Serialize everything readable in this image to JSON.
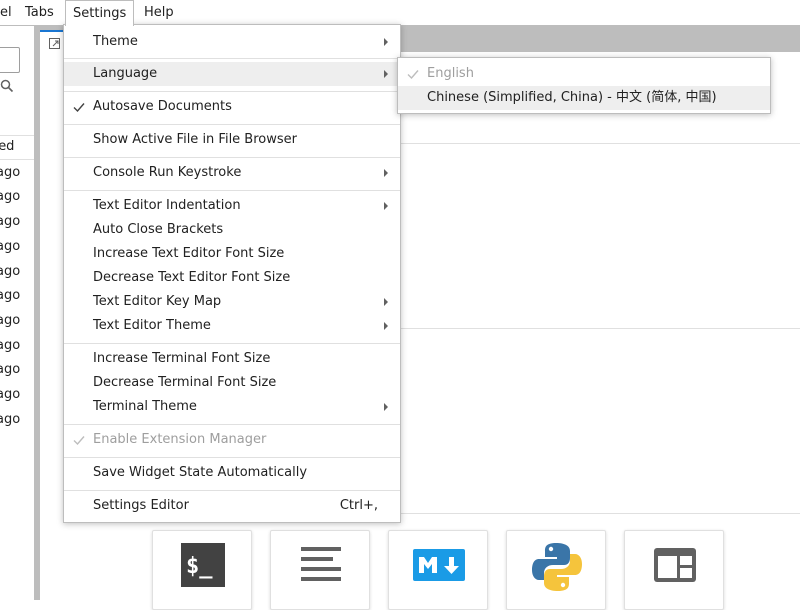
{
  "menubar": {
    "items": [
      "el",
      "Tabs",
      "Settings",
      "Help"
    ]
  },
  "file_browser": {
    "column_header": "fied",
    "rows": [
      "ago",
      "ago",
      "ago",
      "ago",
      "ago",
      "ago",
      "ago",
      "ago",
      "ago",
      "ago",
      "ago"
    ]
  },
  "settings_menu": {
    "theme": "Theme",
    "language": "Language",
    "autosave": "Autosave Documents",
    "show_active_file": "Show Active File in File Browser",
    "console_run_keystroke": "Console Run Keystroke",
    "text_editor_indentation": "Text Editor Indentation",
    "auto_close_brackets": "Auto Close Brackets",
    "increase_editor_font": "Increase Text Editor Font Size",
    "decrease_editor_font": "Decrease Text Editor Font Size",
    "text_editor_key_map": "Text Editor Key Map",
    "text_editor_theme": "Text Editor Theme",
    "increase_terminal_font": "Increase Terminal Font Size",
    "decrease_terminal_font": "Decrease Terminal Font Size",
    "terminal_theme": "Terminal Theme",
    "enable_extension_manager": "Enable Extension Manager",
    "save_widget_state": "Save Widget State Automatically",
    "settings_editor": "Settings Editor",
    "settings_editor_shortcut": "Ctrl+,"
  },
  "language_submenu": {
    "english": "English",
    "chinese": "Chinese (Simplified, China) - 中文 (简体, 中国)"
  },
  "launcher": {
    "cards": [
      "terminal-icon",
      "text-file-icon",
      "markdown-icon",
      "python-icon",
      "show-contextual-help-icon"
    ],
    "markdown_badge": "M"
  },
  "colors": {
    "accent": "#1976d2",
    "menu_hover": "#eeeeee",
    "disabled_text": "#9e9e9e",
    "markdown_blue": "#1a9be6",
    "python_blue": "#3a75a8",
    "python_yellow": "#f5c43c"
  }
}
